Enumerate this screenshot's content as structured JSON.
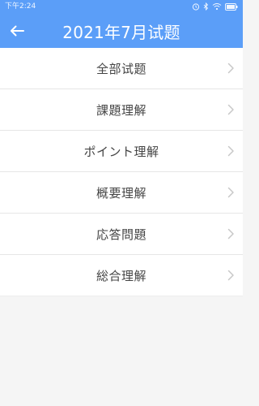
{
  "status_bar": {
    "time": "下午2:24",
    "icons": [
      "alarm-icon",
      "bluetooth-icon",
      "wifi-icon",
      "battery-icon"
    ]
  },
  "header": {
    "title": "2021年7月试题",
    "back_icon": "back-arrow-icon"
  },
  "menu": {
    "items": [
      {
        "label": "全部试题"
      },
      {
        "label": "課題理解"
      },
      {
        "label": "ポイント理解"
      },
      {
        "label": "概要理解"
      },
      {
        "label": "応答問題"
      },
      {
        "label": "総合理解"
      }
    ]
  },
  "colors": {
    "header_bg": "#5b9ef8",
    "page_bg": "#f5f5f5",
    "row_bg": "#ffffff",
    "label_text": "#444444",
    "chevron": "#c8c8c8"
  }
}
